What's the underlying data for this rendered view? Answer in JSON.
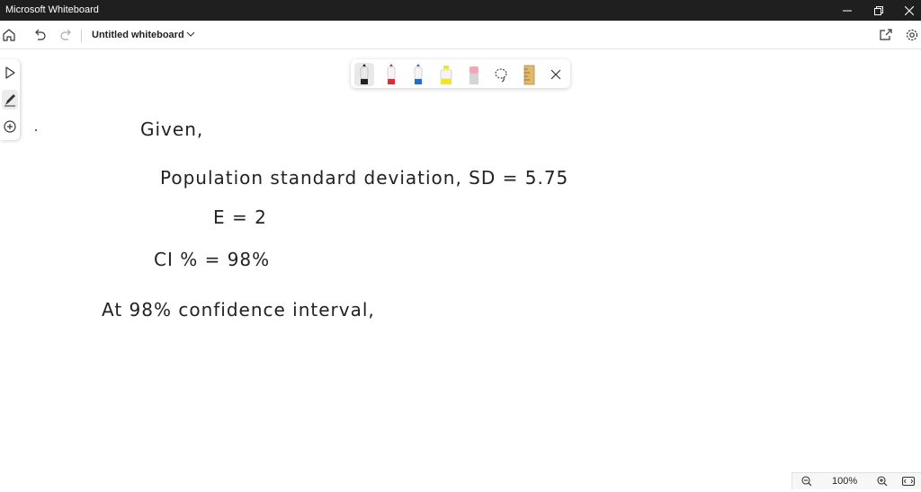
{
  "window": {
    "title": "Microsoft Whiteboard"
  },
  "appbar": {
    "document_title": "Untitled whiteboard"
  },
  "pen_tray": {
    "tools": [
      {
        "name": "black-pen",
        "color": "#222222"
      },
      {
        "name": "red-pen",
        "color": "#e02a3a"
      },
      {
        "name": "blue-pen",
        "color": "#1f6fc4"
      },
      {
        "name": "yellow-highlighter",
        "color": "#f3e428"
      },
      {
        "name": "eraser",
        "color": "#f2a7b8"
      },
      {
        "name": "lasso",
        "color": "#333333"
      },
      {
        "name": "ruler",
        "color": "#e0b96a"
      }
    ]
  },
  "canvas": {
    "lines": [
      "Given,",
      "Population standard deviation, SD = 5.75",
      "E = 2",
      "CI % = 98%",
      "At  98%  confidence  interval,"
    ]
  },
  "zoom": {
    "level": "100%"
  }
}
